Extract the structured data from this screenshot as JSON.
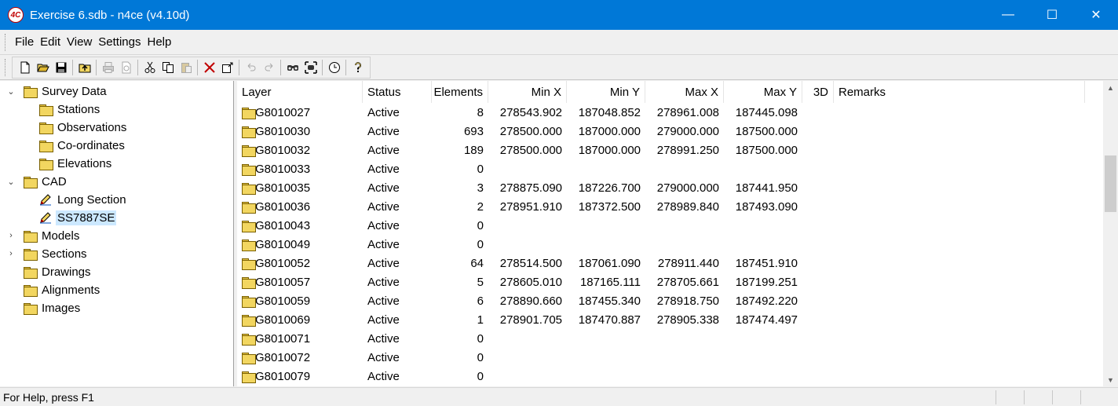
{
  "window": {
    "icon_text": "4C",
    "title": "Exercise 6.sdb - n4ce (v4.10d)",
    "minimize": "—",
    "maximize": "☐",
    "close": "✕"
  },
  "menu": [
    "File",
    "Edit",
    "View",
    "Settings",
    "Help"
  ],
  "toolbar": {
    "icons": [
      "new-file-icon",
      "open-folder-icon",
      "save-icon",
      "up-folder-icon",
      "print-icon",
      "print-preview-icon",
      "cut-icon",
      "copy-icon",
      "paste-icon",
      "delete-icon",
      "properties-icon",
      "undo-icon",
      "redo-icon",
      "binoculars-icon",
      "zoom-extents-icon",
      "clock-icon",
      "help-icon"
    ]
  },
  "tree": {
    "items": [
      {
        "label": "Survey Data",
        "expander": "⌄",
        "indent": 0
      },
      {
        "label": "Stations",
        "expander": "",
        "indent": 1
      },
      {
        "label": "Observations",
        "expander": "",
        "indent": 1
      },
      {
        "label": "Co-ordinates",
        "expander": "",
        "indent": 1
      },
      {
        "label": "Elevations",
        "expander": "",
        "indent": 1
      },
      {
        "label": "CAD",
        "expander": "⌄",
        "indent": 0
      },
      {
        "label": "Long Section",
        "expander": "",
        "indent": 1
      },
      {
        "label": "SS7887SE",
        "expander": "",
        "indent": 1,
        "selected": true
      },
      {
        "label": "Models",
        "expander": "›",
        "indent": 0
      },
      {
        "label": "Sections",
        "expander": "›",
        "indent": 0
      },
      {
        "label": "Drawings",
        "expander": "",
        "indent": 0
      },
      {
        "label": "Alignments",
        "expander": "",
        "indent": 0
      },
      {
        "label": "Images",
        "expander": "",
        "indent": 0
      }
    ]
  },
  "table": {
    "headers": [
      "Layer",
      "Status",
      "Elements",
      "Min X",
      "Min Y",
      "Max X",
      "Max Y",
      "3D",
      "Remarks"
    ],
    "rows": [
      [
        "G8010027",
        "Active",
        "8",
        "278543.902",
        "187048.852",
        "278961.008",
        "187445.098",
        "",
        ""
      ],
      [
        "G8010030",
        "Active",
        "693",
        "278500.000",
        "187000.000",
        "279000.000",
        "187500.000",
        "",
        ""
      ],
      [
        "G8010032",
        "Active",
        "189",
        "278500.000",
        "187000.000",
        "278991.250",
        "187500.000",
        "",
        ""
      ],
      [
        "G8010033",
        "Active",
        "0",
        "",
        "",
        "",
        "",
        "",
        ""
      ],
      [
        "G8010035",
        "Active",
        "3",
        "278875.090",
        "187226.700",
        "279000.000",
        "187441.950",
        "",
        ""
      ],
      [
        "G8010036",
        "Active",
        "2",
        "278951.910",
        "187372.500",
        "278989.840",
        "187493.090",
        "",
        ""
      ],
      [
        "G8010043",
        "Active",
        "0",
        "",
        "",
        "",
        "",
        "",
        ""
      ],
      [
        "G8010049",
        "Active",
        "0",
        "",
        "",
        "",
        "",
        "",
        ""
      ],
      [
        "G8010052",
        "Active",
        "64",
        "278514.500",
        "187061.090",
        "278911.440",
        "187451.910",
        "",
        ""
      ],
      [
        "G8010057",
        "Active",
        "5",
        "278605.010",
        "187165.111",
        "278705.661",
        "187199.251",
        "",
        ""
      ],
      [
        "G8010059",
        "Active",
        "6",
        "278890.660",
        "187455.340",
        "278918.750",
        "187492.220",
        "",
        ""
      ],
      [
        "G8010069",
        "Active",
        "1",
        "278901.705",
        "187470.887",
        "278905.338",
        "187474.497",
        "",
        ""
      ],
      [
        "G8010071",
        "Active",
        "0",
        "",
        "",
        "",
        "",
        "",
        ""
      ],
      [
        "G8010072",
        "Active",
        "0",
        "",
        "",
        "",
        "",
        "",
        ""
      ],
      [
        "G8010079",
        "Active",
        "0",
        "",
        "",
        "",
        "",
        "",
        ""
      ]
    ]
  },
  "statusbar": {
    "text": "For Help, press F1"
  },
  "colors": {
    "titlebar": "#0078d7",
    "selection": "#cce8ff",
    "folder": "#f2d660"
  }
}
